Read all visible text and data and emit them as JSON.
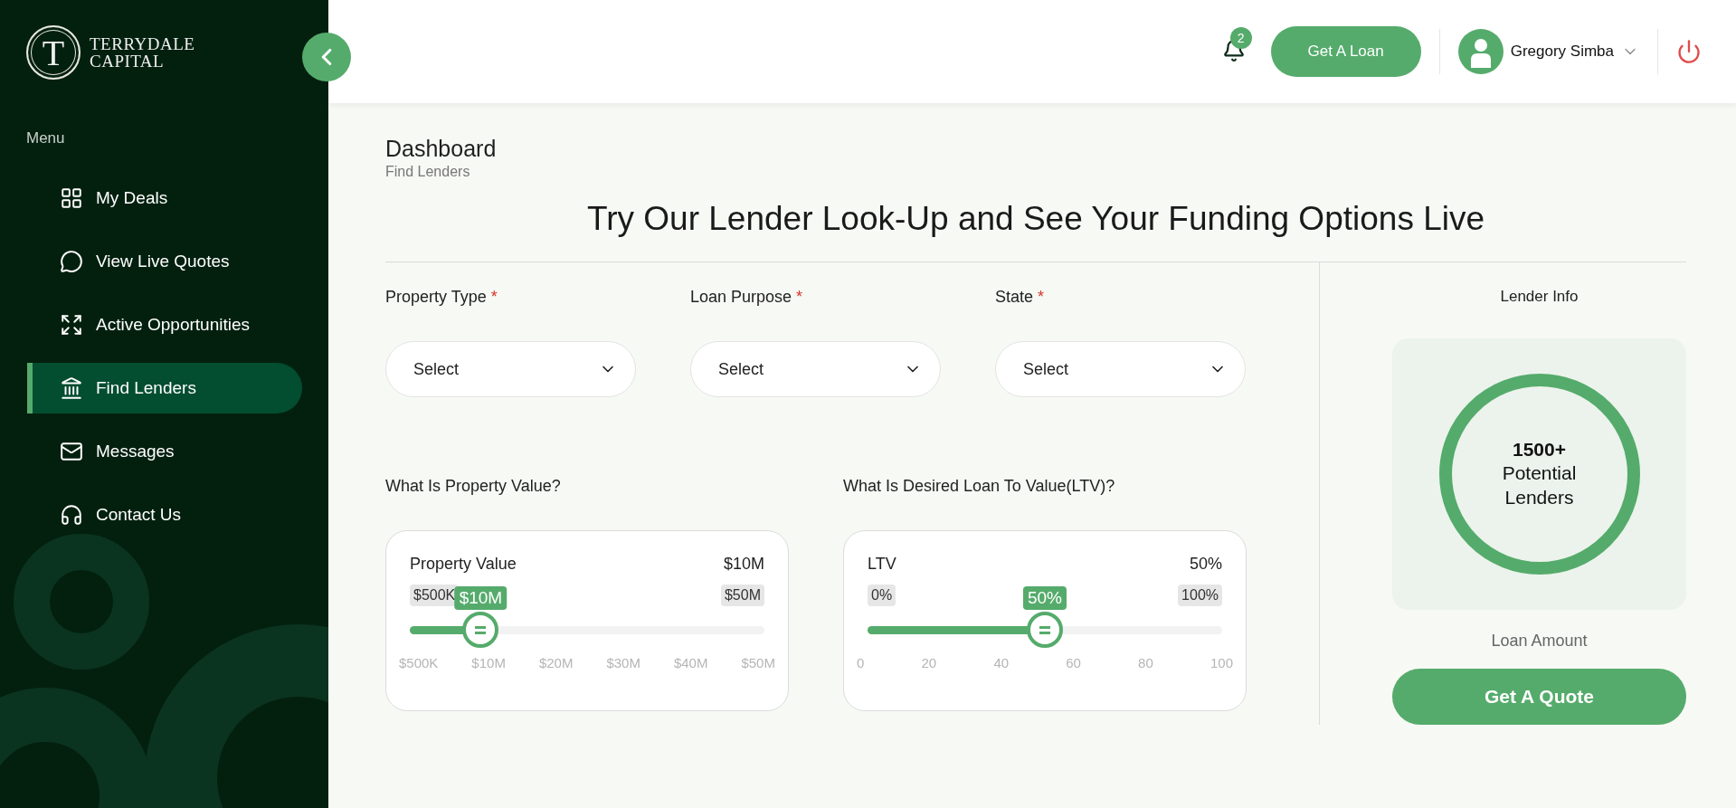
{
  "sidebar": {
    "logo": {
      "mark": "T",
      "lines": [
        "TERRYDALE",
        "CAPITAL"
      ]
    },
    "menu_label": "Menu",
    "items": [
      {
        "label": "My Deals",
        "selected": false
      },
      {
        "label": "View Live Quotes",
        "selected": false
      },
      {
        "label": "Active Opportunities",
        "selected": false
      },
      {
        "label": "Find Lenders",
        "selected": true
      },
      {
        "label": "Messages",
        "selected": false
      },
      {
        "label": "Contact Us",
        "selected": false
      }
    ]
  },
  "header": {
    "notification_count": "2",
    "loan_button": "Get A Loan",
    "user_name": "Gregory Simba"
  },
  "page": {
    "title": "Dashboard",
    "breadcrumb": "Find Lenders"
  },
  "headline": "Try Our Lender Look-Up and See Your Funding Options Live",
  "filters": [
    {
      "label": "Property Type",
      "required_mark": "*",
      "value": "Select"
    },
    {
      "label": "Loan Purpose",
      "required_mark": "*",
      "value": "Select"
    },
    {
      "label": "State",
      "required_mark": "*",
      "value": "Select"
    }
  ],
  "sliders": [
    {
      "question": "What Is Property Value?",
      "title": "Property Value",
      "reading": "$10M",
      "min": "$500K",
      "max": "$50M",
      "bubble": "$10M",
      "level": 0.2,
      "ticks": [
        "$500K",
        "$10M",
        "$20M",
        "$30M",
        "$40M",
        "$50M"
      ]
    },
    {
      "question": "What Is Desired Loan To Value(LTV)?",
      "title": "LTV",
      "reading": "50%",
      "min": "0%",
      "max": "100%",
      "bubble": "50%",
      "level": 0.5,
      "ticks": [
        "0",
        "20",
        "40",
        "60",
        "80",
        "100"
      ]
    }
  ],
  "lender_info": {
    "title": "Lender Info",
    "count": "1500+",
    "count_label": "Potential Lenders",
    "loan_amount_label": "Loan Amount",
    "quote_button": "Get A Quote"
  }
}
